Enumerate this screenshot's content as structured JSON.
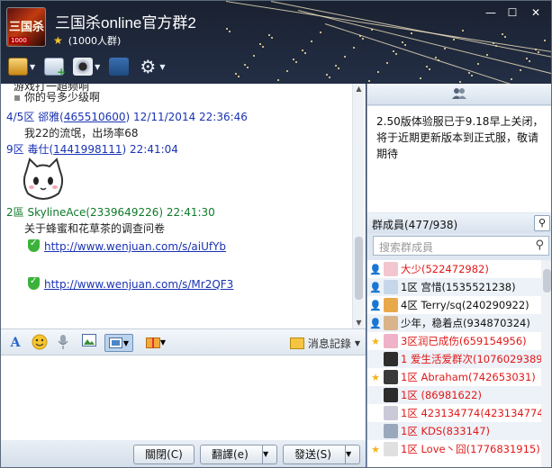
{
  "window": {
    "title": "三国杀online官方群2",
    "member_count_label": "(1000人群)"
  },
  "chat": {
    "cut_line": "游戏打一超频响",
    "messages": [
      {
        "kind": "text",
        "text": "你的号多少级啊"
      },
      {
        "kind": "header",
        "prefix": "4/5区 郤雅",
        "uid": "465510600",
        "time": "12/11/2014 22:36:46"
      },
      {
        "kind": "text",
        "text": "我22的流氓，出场率68"
      },
      {
        "kind": "header",
        "prefix": "9区 毒仕",
        "uid": "1441998111",
        "time": "22:41:04"
      },
      {
        "kind": "header_green",
        "prefix": "2區 SkylineAce(2339649226)",
        "time": "22:41:30"
      },
      {
        "kind": "text",
        "text": "关于蜂蜜和花草茶的调查问卷"
      },
      {
        "kind": "link",
        "text": "http://www.wenjuan.com/s/aiUfYb"
      },
      {
        "kind": "link",
        "text": "http://www.wenjuan.com/s/Mr2QF3"
      }
    ]
  },
  "input_toolbar": {
    "history_label": "消息記錄"
  },
  "bottom_buttons": {
    "close": "關閉(C)",
    "translate": "翻譯(e)",
    "send": "發送(S)"
  },
  "announcement": {
    "text": "2.50版体验服已于9.18早上关闭，将于近期更新版本到正式服，敬请期待"
  },
  "members": {
    "header": "群成員(477/938)",
    "search_placeholder": "搜索群成員",
    "list": [
      {
        "role": "owner",
        "name": "大少(522472982)",
        "color": "red"
      },
      {
        "role": "admin",
        "name": "1区 宫惜(1535521238)",
        "color": "black"
      },
      {
        "role": "admin",
        "name": "4区  Terry/sq(240290922)",
        "color": "black"
      },
      {
        "role": "admin",
        "name": "少年，稳着点(934870324)",
        "color": "black"
      },
      {
        "role": "star",
        "name": "3区润已成伤(659154956)",
        "color": "red"
      },
      {
        "role": "none",
        "name": "1 爱生活爱群次(1076029389)",
        "color": "red"
      },
      {
        "role": "star",
        "name": "1区  Abraham(742653031)",
        "color": "red"
      },
      {
        "role": "none",
        "name": "1区 (86981622)",
        "color": "red"
      },
      {
        "role": "none",
        "name": "1区 423134774(423134774)",
        "color": "red"
      },
      {
        "role": "none",
        "name": "1区 KDS(833147)",
        "color": "red"
      },
      {
        "role": "star",
        "name": "1区 Love丶囧(1776831915)",
        "color": "red"
      }
    ]
  },
  "colors": {
    "link_blue": "#1a33b3",
    "member_red": "#e01818",
    "green_header": "#0f7a2a"
  }
}
